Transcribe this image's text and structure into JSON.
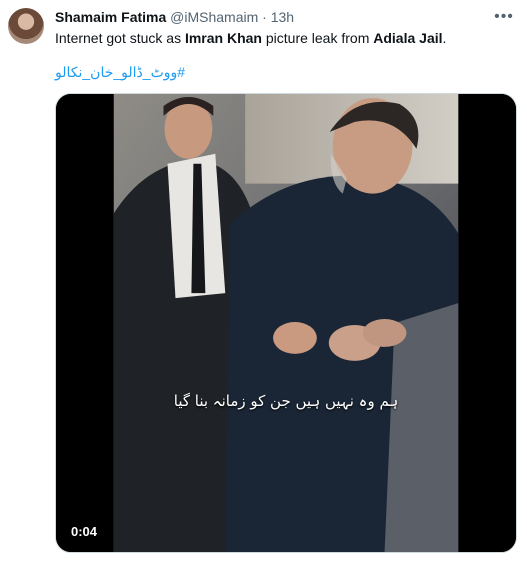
{
  "tweet": {
    "author_name": "Shamaim Fatima",
    "author_handle": "@iMShamaim",
    "separator": "·",
    "time": "13h",
    "text_1": "Internet got stuck as ",
    "text_bold_1": "Imran Khan",
    "text_2": " picture leak from ",
    "text_bold_2": "Adiala Jail",
    "text_3": ".",
    "hashtag": "#ووٹ_ڈالو_خان_نکالو",
    "more_glyph": "•••"
  },
  "media": {
    "video_timestamp": "0:04",
    "caption": "ہم وہ نہیں ہیں جن کو زمانہ بنا گیا"
  },
  "icons": {
    "more": "more-horizontal-icon"
  },
  "colors": {
    "link": "#1d9bf0",
    "secondary_text": "#536471"
  }
}
